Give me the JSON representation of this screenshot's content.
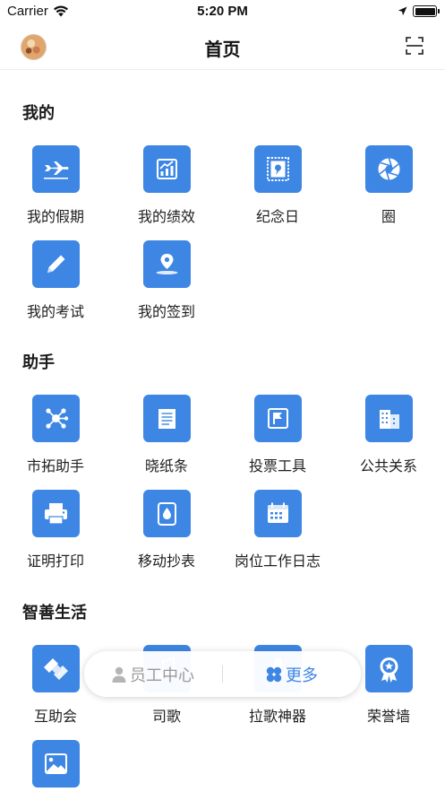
{
  "status_bar": {
    "carrier": "Carrier",
    "time": "5:20 PM"
  },
  "nav": {
    "title": "首页"
  },
  "colors": {
    "accent": "#3d86e4"
  },
  "sections": [
    {
      "title": "我的",
      "items": [
        {
          "label": "我的假期",
          "icon": "airplane-icon"
        },
        {
          "label": "我的绩效",
          "icon": "growth-chart-icon"
        },
        {
          "label": "纪念日",
          "icon": "stamp-icon"
        },
        {
          "label": "圈",
          "icon": "aperture-icon"
        },
        {
          "label": "我的考试",
          "icon": "pencil-icon"
        },
        {
          "label": "我的签到",
          "icon": "location-pin-icon"
        }
      ]
    },
    {
      "title": "助手",
      "items": [
        {
          "label": "市拓助手",
          "icon": "network-nodes-icon"
        },
        {
          "label": "晓纸条",
          "icon": "note-paper-icon"
        },
        {
          "label": "投票工具",
          "icon": "flag-icon"
        },
        {
          "label": "公共关系",
          "icon": "building-icon"
        },
        {
          "label": "证明打印",
          "icon": "printer-icon"
        },
        {
          "label": "移动抄表",
          "icon": "water-meter-icon"
        },
        {
          "label": "岗位工作日志",
          "icon": "calendar-icon"
        }
      ]
    },
    {
      "title": "智善生活",
      "items": [
        {
          "label": "互助会",
          "icon": "handshake-icon"
        },
        {
          "label": "司歌",
          "icon": "music-icon"
        },
        {
          "label": "拉歌神器",
          "icon": "microphone-icon"
        },
        {
          "label": "荣誉墙",
          "icon": "medal-icon"
        },
        {
          "label": "",
          "icon": "image-icon"
        }
      ]
    }
  ],
  "bottom_switch": {
    "staff_center": "员工中心",
    "more": "更多"
  }
}
